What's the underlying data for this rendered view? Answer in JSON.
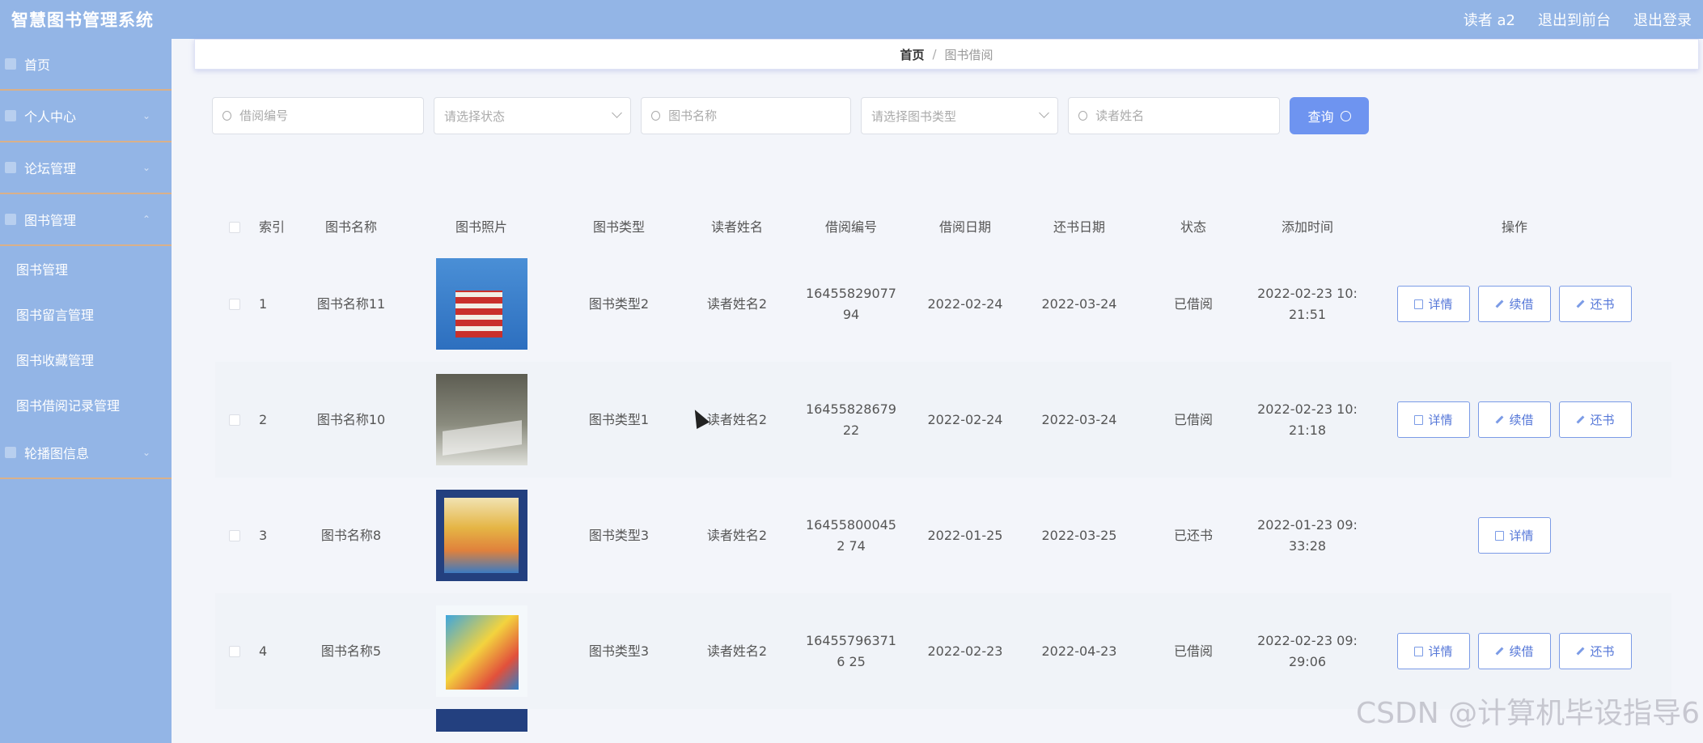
{
  "header": {
    "app_title": "智慧图书管理系统",
    "user": "读者 a2",
    "to_front": "退出到前台",
    "logout": "退出登录"
  },
  "sidebar": {
    "items": [
      {
        "label": "首页",
        "icon": "home-icon"
      },
      {
        "label": "个人中心",
        "icon": "user-icon"
      },
      {
        "label": "论坛管理",
        "icon": "forum-icon"
      },
      {
        "label": "图书管理",
        "icon": "book-icon"
      }
    ],
    "sub_items": [
      "图书管理",
      "图书留言管理",
      "图书收藏管理",
      "图书借阅记录管理"
    ],
    "last_item": {
      "label": "轮播图信息",
      "icon": "image-icon"
    }
  },
  "breadcrumb": {
    "home": "首页",
    "sep": "/",
    "current": "图书借阅"
  },
  "search": {
    "borrow_no_placeholder": "借阅编号",
    "status_placeholder": "请选择状态",
    "book_name_placeholder": "图书名称",
    "book_type_placeholder": "请选择图书类型",
    "reader_placeholder": "读者姓名",
    "query_label": "查询"
  },
  "table": {
    "headers": {
      "index": "索引",
      "name": "图书名称",
      "image": "图书照片",
      "type": "图书类型",
      "reader": "读者姓名",
      "borrow_no": "借阅编号",
      "borrow_date": "借阅日期",
      "return_date": "还书日期",
      "status": "状态",
      "added": "添加时间",
      "ops": "操作"
    },
    "buttons": {
      "detail": "详情",
      "renew": "续借",
      "return": "还书"
    },
    "rows": [
      {
        "index": "1",
        "name": "图书名称11",
        "type": "图书类型2",
        "reader": "读者姓名2",
        "borrow_no": "1645582907794",
        "borrow_date": "2022-02-24",
        "return_date": "2022-03-24",
        "status": "已借阅",
        "added": "2022-02-23 10:21:51"
      },
      {
        "index": "2",
        "name": "图书名称10",
        "type": "图书类型1",
        "reader": "读者姓名2",
        "borrow_no": "1645582867922",
        "borrow_date": "2022-02-24",
        "return_date": "2022-03-24",
        "status": "已借阅",
        "added": "2022-02-23 10:21:18"
      },
      {
        "index": "3",
        "name": "图书名称8",
        "type": "图书类型3",
        "reader": "读者姓名2",
        "borrow_no": "164558000452 74",
        "borrow_date": "2022-01-25",
        "return_date": "2022-03-25",
        "status": "已还书",
        "added": "2022-01-23 09:33:28"
      },
      {
        "index": "4",
        "name": "图书名称5",
        "type": "图书类型3",
        "reader": "读者姓名2",
        "borrow_no": "164557963716 25",
        "borrow_date": "2022-02-23",
        "return_date": "2022-04-23",
        "status": "已借阅",
        "added": "2022-02-23 09:29:06"
      }
    ]
  },
  "watermark": "CSDN @计算机毕设指导6"
}
